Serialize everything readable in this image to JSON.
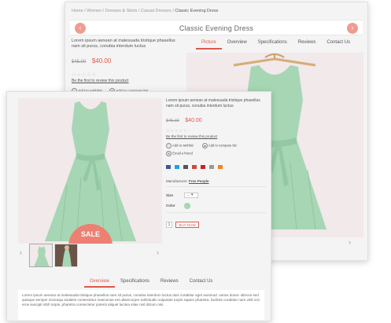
{
  "breadcrumb": {
    "home": "Home",
    "sep": "/",
    "women": "Women",
    "dresses": "Dresses & Skirts",
    "casual": "Casual Dresses",
    "current": "Classic Evening Dress"
  },
  "product": {
    "title": "Classic Evening Dress",
    "desc_short": "Lorem ipsum aenean at malesuada tristique phasellus nam sit purus, conubia interdum luctus",
    "old_price": "$45.00",
    "new_price": "$40.00",
    "stars": "☆☆☆☆☆",
    "review_link": "Be the first to review this product",
    "wishlist": "Add to wishlist",
    "compare": "Add to compare list",
    "email": "Email a friend",
    "manufacturer_label": "Manufacturer:",
    "manufacturer": "Free People",
    "size_label": "Size",
    "size_value": "...",
    "color_label": "Color",
    "qty": "1",
    "buy": "BUY NOW",
    "sale": "SALE"
  },
  "back_tabs": [
    "Picture",
    "Overview",
    "Specifications",
    "Reviews",
    "Contact Us"
  ],
  "front_tabs": [
    "Overview",
    "Specifications",
    "Reviews",
    "Contact Us"
  ],
  "long_desc": "Lorem ipsum aenean at malesuada tristique phasellus nam sit purus, conubia interdum luctus duis curabitur eget euismod. varius donec ultrices sed quisque semper sociosqu sodales consectetur maecenas est ullamcorper sollicitudin vulputate turpis sapien pharetra. facilisis curabitur nam velit orci eros suscipit nibh turpis, pharetra consectetur potenti aliquet lacinia vitae nisl dictum nisi.",
  "colors": {
    "accent": "#e0584a",
    "sale": "#ed7f73",
    "dress": "#a7d6b4",
    "photo_bg": "#f1e9ea",
    "swatch": "#a7d6b4"
  },
  "icons": {
    "heart": "♡",
    "compare": "⇄",
    "mail": "✉",
    "prev": "‹",
    "next": "›",
    "caret": "▾"
  }
}
